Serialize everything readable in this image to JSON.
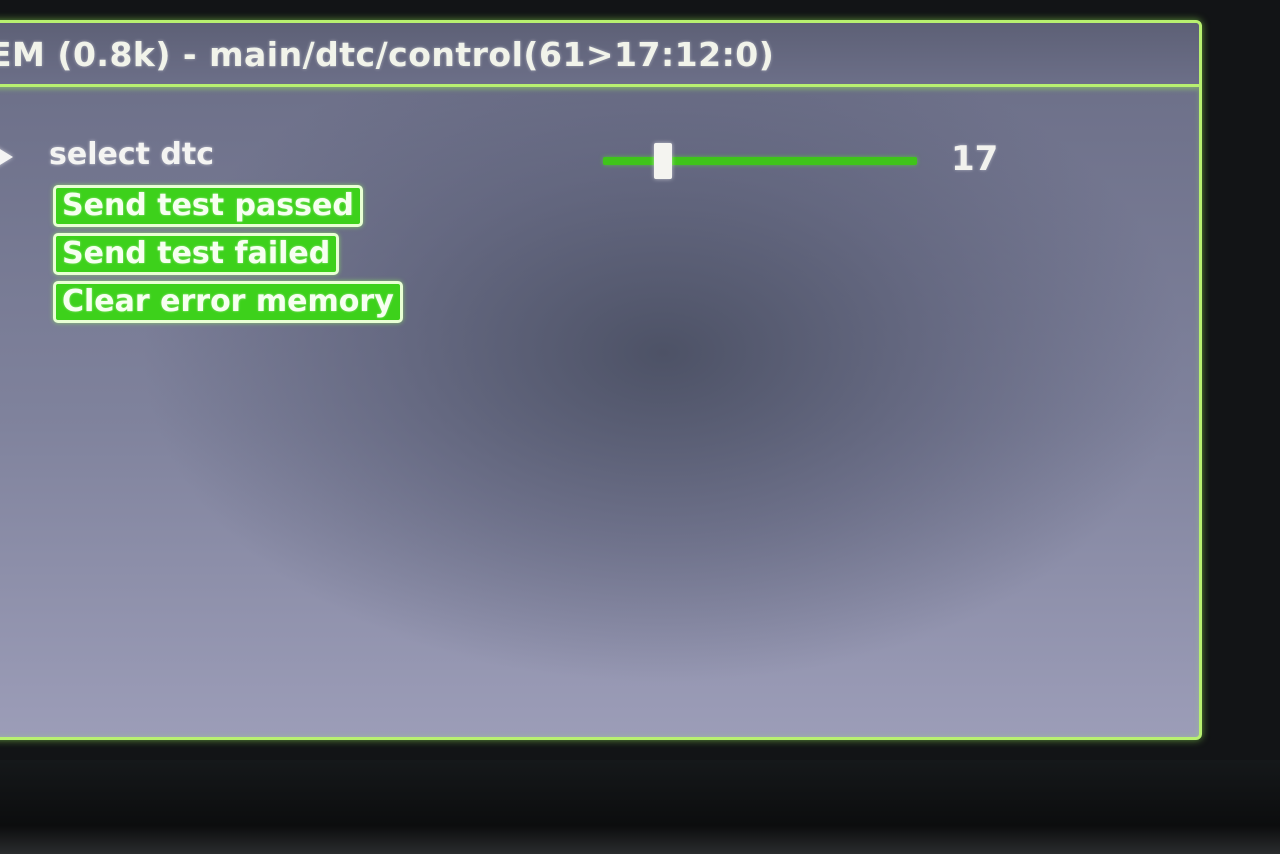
{
  "header": {
    "title": "EM (0.8k) - main/dtc/control(61>17:12:0)"
  },
  "control": {
    "label": "select dtc",
    "slider_value": "17",
    "slider_fraction": 0.19
  },
  "actions": [
    {
      "label": "Send test passed"
    },
    {
      "label": "Send test failed"
    },
    {
      "label": "Clear error memory"
    }
  ],
  "colors": {
    "accent_green": "#3dd11b",
    "frame_glow": "#b8f070",
    "text": "#f4f4f2"
  }
}
